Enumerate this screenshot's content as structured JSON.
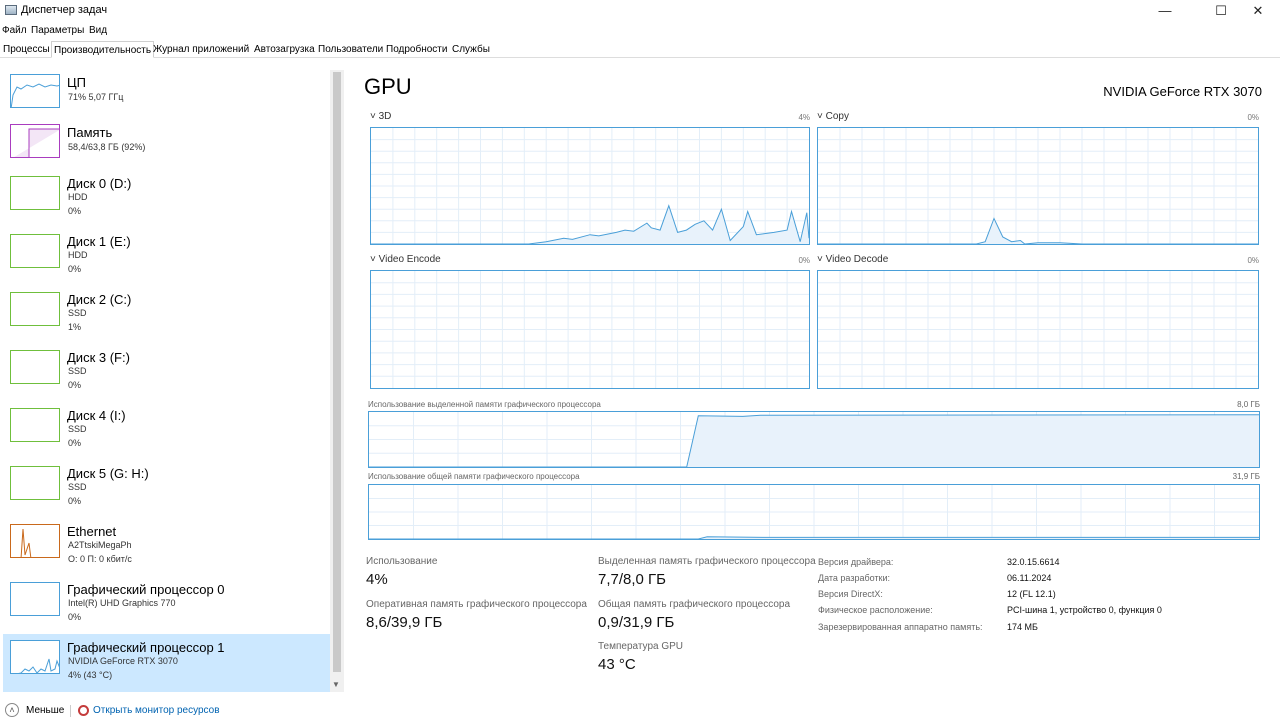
{
  "window": {
    "title": "Диспетчер задач",
    "minimize_glyph": "—",
    "maximize_glyph": "☐",
    "close_glyph": "✕"
  },
  "menu": [
    "Файл",
    "Параметры",
    "Вид"
  ],
  "tabs": [
    "Процессы",
    "Производительность",
    "Журнал приложений",
    "Автозагрузка",
    "Пользователи",
    "Подробности",
    "Службы"
  ],
  "active_tab": "Производительность",
  "sidebar": {
    "items": [
      {
        "name": "ЦП",
        "sub1": "71%  5,07 ГГц",
        "sub2": "",
        "color": "#4a9fd8",
        "selected": false
      },
      {
        "name": "Память",
        "sub1": "58,4/63,8 ГБ (92%)",
        "sub2": "",
        "color": "#a93cbf",
        "selected": false
      },
      {
        "name": "Диск 0 (D:)",
        "sub1": "HDD",
        "sub2": "0%",
        "color": "#6fbf3c",
        "selected": false
      },
      {
        "name": "Диск 1 (E:)",
        "sub1": "HDD",
        "sub2": "0%",
        "color": "#6fbf3c",
        "selected": false
      },
      {
        "name": "Диск 2 (C:)",
        "sub1": "SSD",
        "sub2": "1%",
        "color": "#6fbf3c",
        "selected": false
      },
      {
        "name": "Диск 3 (F:)",
        "sub1": "SSD",
        "sub2": "0%",
        "color": "#6fbf3c",
        "selected": false
      },
      {
        "name": "Диск 4 (I:)",
        "sub1": "SSD",
        "sub2": "0%",
        "color": "#6fbf3c",
        "selected": false
      },
      {
        "name": "Диск 5 (G: H:)",
        "sub1": "SSD",
        "sub2": "0%",
        "color": "#6fbf3c",
        "selected": false
      },
      {
        "name": "Ethernet",
        "sub1": "A2TtskiMegaPh",
        "sub2": "О: 0 П: 0 кбит/с",
        "color": "#c9691c",
        "selected": false
      },
      {
        "name": "Графический процессор 0",
        "sub1": "Intel(R) UHD Graphics 770",
        "sub2": "0%",
        "color": "#4a9fd8",
        "selected": false
      },
      {
        "name": "Графический процессор 1",
        "sub1": "NVIDIA GeForce RTX 3070",
        "sub2": "4% (43 °C)",
        "color": "#4a9fd8",
        "selected": true
      }
    ]
  },
  "main": {
    "title": "GPU",
    "model": "NVIDIA GeForce RTX 3070",
    "engines": [
      {
        "label": "3D",
        "pct": "4%"
      },
      {
        "label": "Copy",
        "pct": "0%"
      },
      {
        "label": "Video Encode",
        "pct": "0%"
      },
      {
        "label": "Video Decode",
        "pct": "0%"
      }
    ],
    "dedicated_label": "Использование выделенной памяти графического процессора",
    "dedicated_max": "8,0 ГБ",
    "shared_label": "Использование общей памяти графического процессора",
    "shared_max": "31,9 ГБ",
    "stats": {
      "usage_label": "Использование",
      "usage": "4%",
      "ram_label": "Оперативная память графического процессора",
      "ram": "8,6/39,9 ГБ",
      "dedicated_label": "Выделенная память графического процессора",
      "dedicated": "7,7/8,0 ГБ",
      "shared_label": "Общая память графического процессора",
      "shared": "0,9/31,9 ГБ",
      "temp_label": "Температура GPU",
      "temp": "43 °C"
    },
    "info": [
      {
        "k": "Версия драйвера:",
        "v": "32.0.15.6614"
      },
      {
        "k": "Дата разработки:",
        "v": "06.11.2024"
      },
      {
        "k": "Версия DirectX:",
        "v": "12 (FL 12.1)"
      },
      {
        "k": "Физическое расположение:",
        "v": "PCI-шина 1, устройство 0, функция 0"
      },
      {
        "k": "Зарезервированная аппаратно память:",
        "v": "174 МБ"
      }
    ]
  },
  "footer": {
    "less": "Меньше",
    "monitor": "Открыть монитор ресурсов"
  },
  "colors": {
    "graph_line": "#4a9fd8",
    "graph_fill": "#e8f2fb",
    "selected_bg": "#cce8ff",
    "link": "#0063b1"
  }
}
